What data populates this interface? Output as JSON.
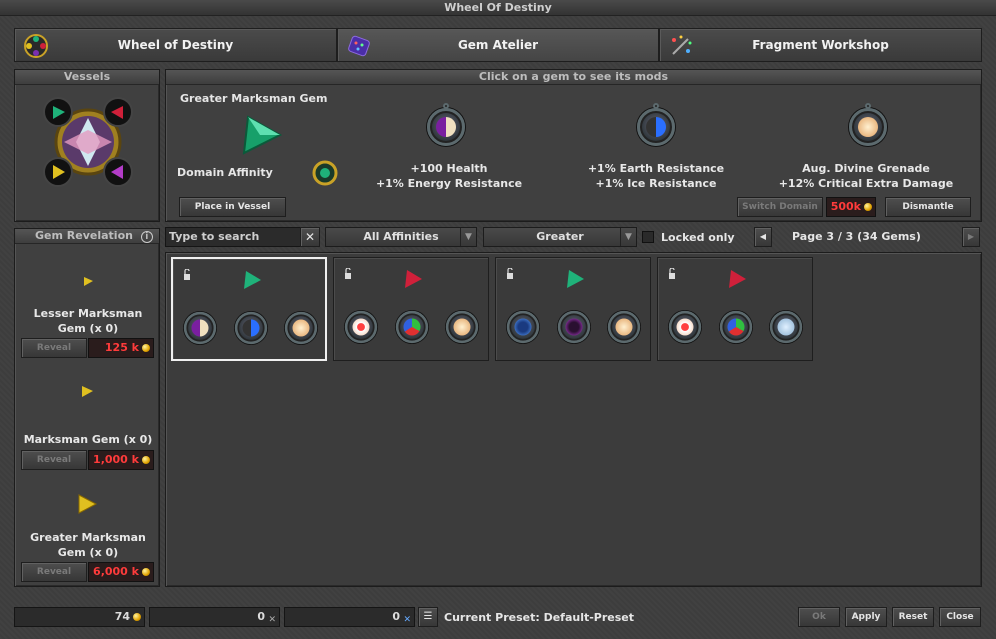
{
  "window": {
    "title": "Wheel Of Destiny"
  },
  "tabs": [
    {
      "label": "Wheel of Destiny"
    },
    {
      "label": "Gem Atelier"
    },
    {
      "label": "Fragment Workshop"
    }
  ],
  "vessels": {
    "header": "Vessels"
  },
  "details": {
    "header": "Click on a gem to see its mods",
    "gem_name": "Greater Marksman Gem",
    "domain_label": "Domain Affinity",
    "place_button": "Place in Vessel",
    "mods": [
      {
        "line1": "+100 Health",
        "line2": "+1% Energy Resistance"
      },
      {
        "line1": "+1% Earth Resistance",
        "line2": "+1% Ice Resistance"
      },
      {
        "line1": "Aug. Divine Grenade",
        "line2": "+12% Critical Extra Damage"
      }
    ],
    "switch_domain_button": "Switch Domain",
    "switch_price": "500k",
    "dismantle_button": "Dismantle"
  },
  "revelation": {
    "header": "Gem Revelation",
    "info_icon": "i",
    "items": [
      {
        "name_line1": "Lesser Marksman",
        "name_line2": "Gem (x 0)",
        "button": "Reveal",
        "price": "125 k"
      },
      {
        "name_line1": "Marksman Gem (x 0)",
        "name_line2": "",
        "button": "Reveal",
        "price": "1,000 k"
      },
      {
        "name_line1": "Greater Marksman",
        "name_line2": "Gem (x 0)",
        "button": "Reveal",
        "price": "6,000 k"
      }
    ]
  },
  "filters": {
    "search_placeholder": "Type to search",
    "clear": "✕",
    "affinity": "All Affinities",
    "size": "Greater",
    "locked_only": "Locked only",
    "page_info": "Page 3 / 3 (34 Gems)",
    "prev": "◀",
    "next": "▶"
  },
  "gems": [
    {
      "color": "#1fb27a",
      "sockets": [
        "health-energy",
        "earth-ice",
        "grenade"
      ]
    },
    {
      "color": "#d0203a",
      "sockets": [
        "health",
        "multi-res",
        "grenade-red"
      ]
    },
    {
      "color": "#1fb27a",
      "sockets": [
        "ice-shield",
        "energy-shield",
        "grenade"
      ]
    },
    {
      "color": "#d0203a",
      "sockets": [
        "health",
        "multi-res",
        "marksman"
      ]
    }
  ],
  "footer": {
    "gold": "74",
    "fragments_1": "0",
    "fragments_2": "0",
    "preset_label": "Current Preset: Default-Preset",
    "ok": "Ok",
    "apply": "Apply",
    "reset": "Reset",
    "close": "Close"
  },
  "colors": {
    "price_red": "#ff3b3b",
    "accent_gold": "#e2a300"
  }
}
